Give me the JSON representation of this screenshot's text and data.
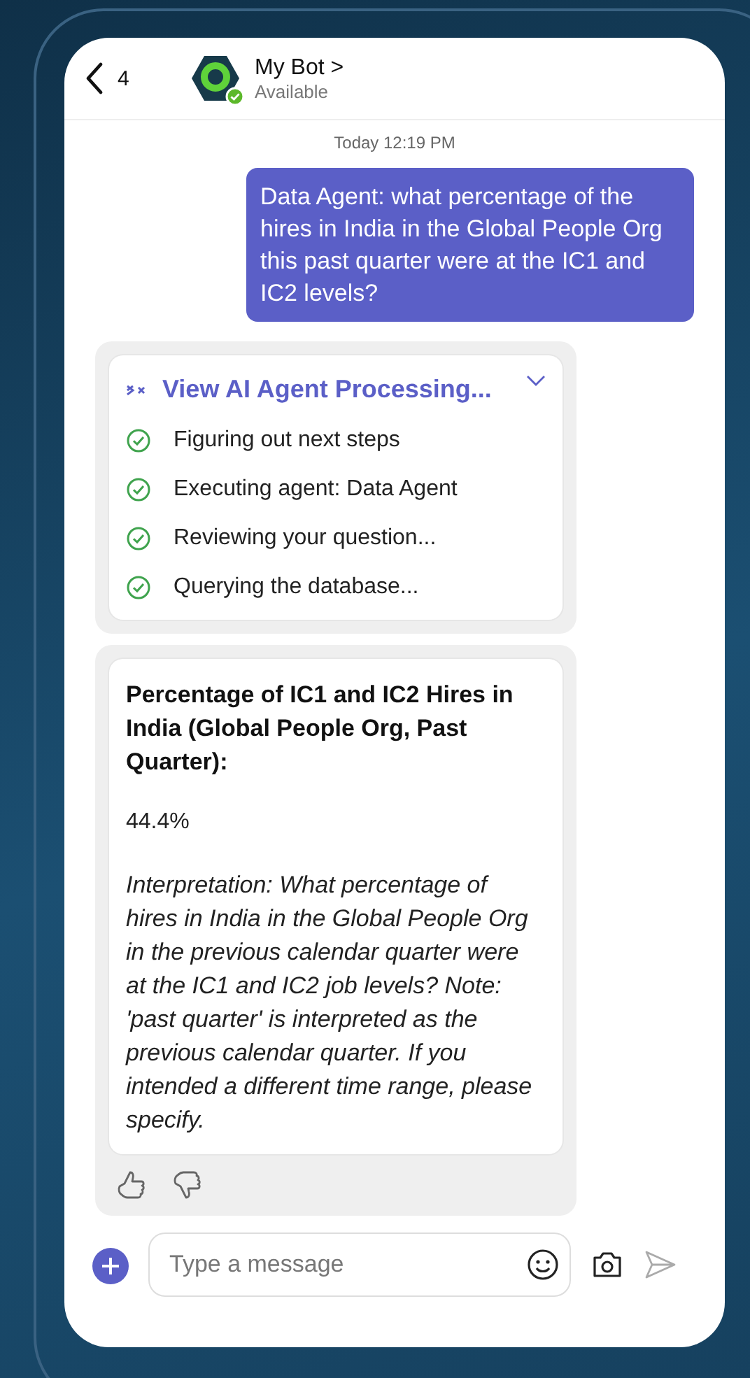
{
  "header": {
    "back_count": "4",
    "bot_name": "My Bot",
    "chevron": ">",
    "status": "Available",
    "online": true
  },
  "timestamp": "Today 12:19 PM",
  "user_message": "Data Agent: what percentage of the hires in India in the Global People Org this past quarter were at the IC1 and IC2 levels?",
  "processing": {
    "title": "View AI Agent Processing...",
    "steps": [
      {
        "label": "Figuring out next steps",
        "done": true
      },
      {
        "label": "Executing agent: Data Agent",
        "done": true
      },
      {
        "label": "Reviewing your question...",
        "done": true
      },
      {
        "label": "Querying the database...",
        "done": true
      }
    ]
  },
  "answer": {
    "title": "Percentage of IC1 and IC2 Hires in India (Global People Org, Past Quarter):",
    "value": "44.4%",
    "interpretation": "Interpretation: What percentage of hires in India in the Global People Org in the previous calendar quarter were at the IC1 and IC2 job levels? Note: 'past quarter' is interpreted as the previous calendar quarter. If you intended a different time range, please specify."
  },
  "composer": {
    "placeholder": "Type a message"
  }
}
